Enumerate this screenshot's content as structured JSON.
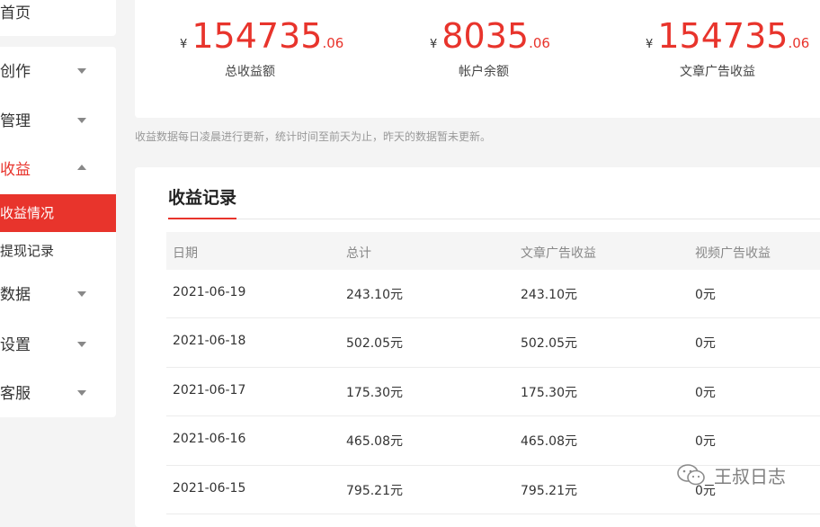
{
  "sidebar": {
    "home_label": "首页",
    "items": [
      {
        "label": "创作",
        "open": false
      },
      {
        "label": "管理",
        "open": false
      },
      {
        "label": "收益",
        "open": true
      },
      {
        "label": "数据",
        "open": false
      },
      {
        "label": "设置",
        "open": false
      },
      {
        "label": "客服",
        "open": false
      }
    ],
    "sub_items": [
      {
        "label": "收益情况",
        "active": true
      },
      {
        "label": "提现记录",
        "active": false
      }
    ]
  },
  "stats": [
    {
      "currency": "¥",
      "integer": "154735",
      "decimal": ".06",
      "label": "总收益额"
    },
    {
      "currency": "¥",
      "integer": "8035",
      "decimal": ".06",
      "label": "帐户余额"
    },
    {
      "currency": "¥",
      "integer": "154735",
      "decimal": ".06",
      "label": "文章广告收益"
    }
  ],
  "note": "收益数据每日凌晨进行更新，统计时间至前天为止，昨天的数据暂未更新。",
  "records": {
    "title": "收益记录",
    "columns": [
      "日期",
      "总计",
      "文章广告收益",
      "视频广告收益"
    ],
    "rows": [
      [
        "2021-06-19",
        "243.10元",
        "243.10元",
        "0元"
      ],
      [
        "2021-06-18",
        "502.05元",
        "502.05元",
        "0元"
      ],
      [
        "2021-06-17",
        "175.30元",
        "175.30元",
        "0元"
      ],
      [
        "2021-06-16",
        "465.08元",
        "465.08元",
        "0元"
      ],
      [
        "2021-06-15",
        "795.21元",
        "795.21元",
        "0元"
      ]
    ]
  },
  "watermark": {
    "text": "王叔日志",
    "icon": "wechat-icon"
  },
  "colors": {
    "accent": "#e8342c",
    "background": "#f4f4f4",
    "card": "#ffffff"
  }
}
